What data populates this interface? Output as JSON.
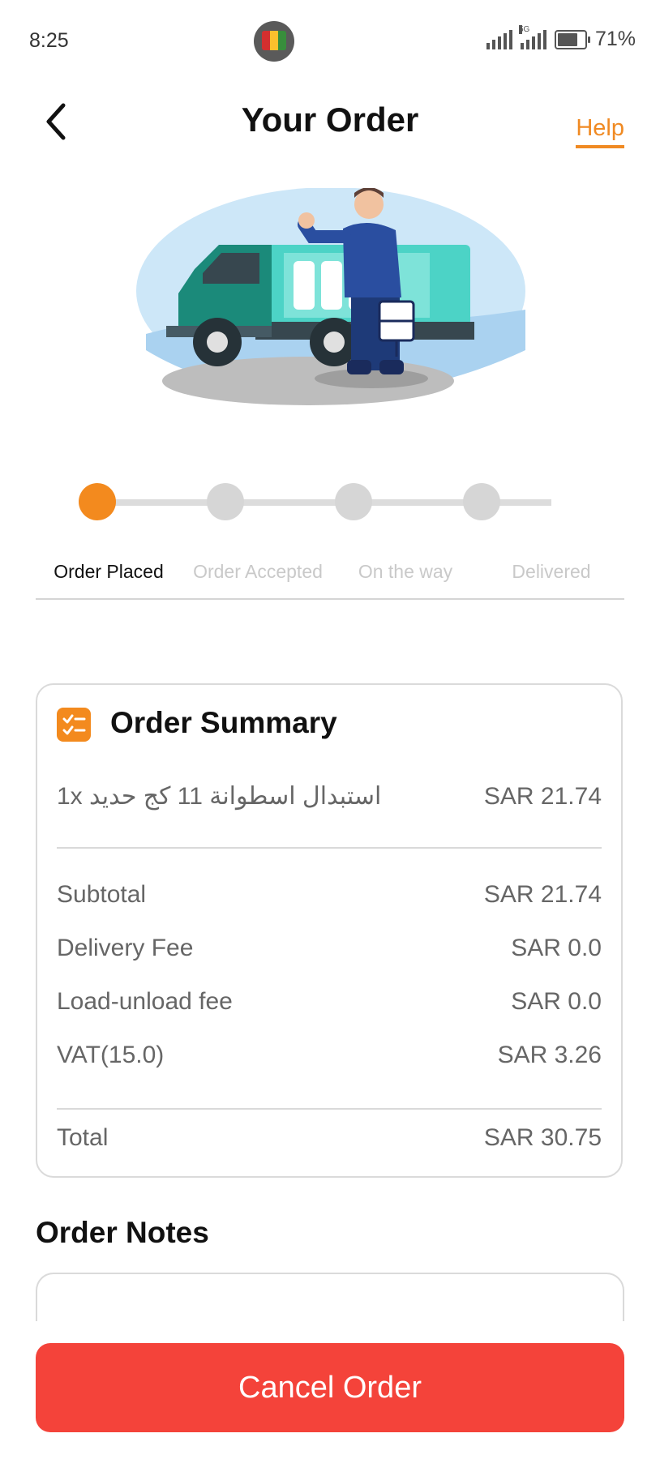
{
  "status_bar": {
    "time": "8:25",
    "network_label": "5G",
    "battery_percent": "71%",
    "battery_level": 0.71
  },
  "header": {
    "title": "Your Order",
    "help_label": "Help"
  },
  "colors": {
    "accent": "#f38a1e",
    "cancel": "#f4433a",
    "inactive_step": "#d6d6d6"
  },
  "progress": {
    "current_step_index": 0,
    "steps": [
      {
        "label": "Order Placed"
      },
      {
        "label": "Order Accepted"
      },
      {
        "label": "On the way"
      },
      {
        "label": "Delivered"
      }
    ]
  },
  "summary": {
    "title": "Order Summary",
    "items": [
      {
        "name": "1x استبدال اسطوانة 11 كج حديد",
        "price": "SAR 21.74"
      }
    ],
    "subtotal_label": "Subtotal",
    "subtotal_value": "SAR 21.74",
    "delivery_label": "Delivery Fee",
    "delivery_value": "SAR 0.0",
    "load_label": "Load-unload fee",
    "load_value": "SAR 0.0",
    "vat_label": "VAT(15.0)",
    "vat_value": "SAR 3.26",
    "total_label": "Total",
    "total_value": "SAR 30.75"
  },
  "notes": {
    "title": "Order Notes",
    "value": ""
  },
  "actions": {
    "cancel_label": "Cancel Order"
  }
}
